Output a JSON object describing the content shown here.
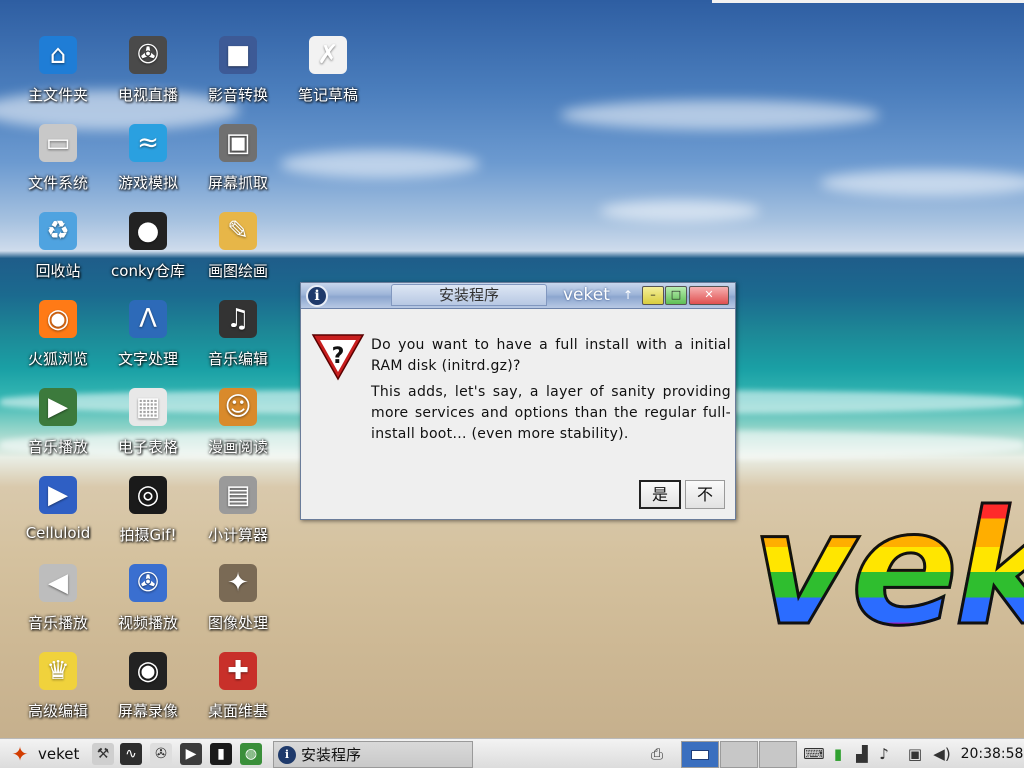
{
  "desktop": {
    "icons": [
      {
        "label": "主文件夹",
        "icon": "home-folder-icon",
        "glyph": "⌂",
        "bg": "#1f7dd6"
      },
      {
        "label": "电视直播",
        "icon": "tv-film-reel-icon",
        "glyph": "✇",
        "bg": "#4a4a4a"
      },
      {
        "label": "影音转换",
        "icon": "video-camera-icon",
        "glyph": "■",
        "bg": "#3d5a96"
      },
      {
        "label": "笔记草稿",
        "icon": "notes-pen-icon",
        "glyph": "✗",
        "bg": "#f2f2f2"
      },
      {
        "label": "文件系统",
        "icon": "hard-drive-icon",
        "glyph": "▭",
        "bg": "#c8c8c8"
      },
      {
        "label": "游戏模拟",
        "icon": "dolphin-icon",
        "glyph": "≈",
        "bg": "#2aa0e0"
      },
      {
        "label": "屏幕抓取",
        "icon": "screenshot-camera-icon",
        "glyph": "▣",
        "bg": "#707070"
      },
      {
        "label": "回收站",
        "icon": "recycle-bin-icon",
        "glyph": "♻",
        "bg": "#4fa3e0"
      },
      {
        "label": "conky仓库",
        "icon": "tux-penguin-icon",
        "glyph": "●",
        "bg": "#222222"
      },
      {
        "label": "画图绘画",
        "icon": "paint-palette-icon",
        "glyph": "✎",
        "bg": "#e7b648"
      },
      {
        "label": "火狐浏览",
        "icon": "firefox-icon",
        "glyph": "◉",
        "bg": "#ff7a16"
      },
      {
        "label": "文字处理",
        "icon": "abiword-icon",
        "glyph": "Λ",
        "bg": "#2d6ab8"
      },
      {
        "label": "音乐编辑",
        "icon": "audio-editor-icon",
        "glyph": "♫",
        "bg": "#333333"
      },
      {
        "label": "音乐播放",
        "icon": "audio-player-icon",
        "glyph": "▶",
        "bg": "#3c7a3c"
      },
      {
        "label": "电子表格",
        "icon": "spreadsheet-icon",
        "glyph": "▦",
        "bg": "#e8e8e8"
      },
      {
        "label": "漫画阅读",
        "icon": "monkey-icon",
        "glyph": "☺",
        "bg": "#d98a2b"
      },
      {
        "label": "Celluloid",
        "icon": "celluloid-film-icon",
        "glyph": "▶",
        "bg": "#2f5fc4"
      },
      {
        "label": "拍摄Gif!",
        "icon": "gif-camera-icon",
        "glyph": "◎",
        "bg": "#1a1a1a"
      },
      {
        "label": "小计算器",
        "icon": "calculator-icon",
        "glyph": "▤",
        "bg": "#9a9a9a"
      },
      {
        "label": "音乐播放",
        "icon": "speaker-icon",
        "glyph": "◀",
        "bg": "#bdbdbd"
      },
      {
        "label": "视频播放",
        "icon": "video-player-icon",
        "glyph": "✇",
        "bg": "#3a6fd0"
      },
      {
        "label": "图像处理",
        "icon": "gimp-icon",
        "glyph": "✦",
        "bg": "#7a6a55"
      },
      {
        "label": "高级编辑",
        "icon": "genie-lamp-icon",
        "glyph": "♛",
        "bg": "#f0d23c"
      },
      {
        "label": "屏幕录像",
        "icon": "screen-recorder-icon",
        "glyph": "◉",
        "bg": "#222222"
      },
      {
        "label": "桌面维基",
        "icon": "desktop-wiki-icon",
        "glyph": "✚",
        "bg": "#c8302a"
      }
    ],
    "logo_text": "veket"
  },
  "dialog": {
    "tab_title": "安装程序",
    "window_title": "veket",
    "pin_glyph": "↑",
    "min_glyph": "–",
    "max_glyph": "□",
    "close_glyph": "✕",
    "info_glyph": "i",
    "message_line1": "Do you want to have a full install with a initial RAM disk (initrd.gz)?",
    "message_line2": "This adds, let's say, a layer of sanity providing more services and options than the regular full-install boot... (even more stability).",
    "yes_label": "是",
    "no_label": "不"
  },
  "taskbar": {
    "start_label": "veket",
    "start_glyph": "✦",
    "quicklaunch": [
      {
        "icon": "paint-roller-icon",
        "glyph": "⚒",
        "bg": "#cfcfcf"
      },
      {
        "icon": "system-monitor-icon",
        "glyph": "∿",
        "bg": "#2e2e2e"
      },
      {
        "icon": "film-reel-icon",
        "glyph": "✇",
        "bg": "#dedede"
      },
      {
        "icon": "media-play-icon",
        "glyph": "▶",
        "bg": "#3c3c3c"
      },
      {
        "icon": "terminal-icon",
        "glyph": "▮",
        "bg": "#1b1b1b"
      },
      {
        "icon": "globe-icon",
        "glyph": "◍",
        "bg": "#3a8f3a"
      }
    ],
    "task_button_label": "安装程序",
    "tray": [
      {
        "icon": "printer-icon",
        "glyph": "⎙"
      },
      {
        "icon": "keyboard-icon",
        "glyph": "⌨"
      },
      {
        "icon": "drive-cylinder-icon",
        "glyph": "▮"
      },
      {
        "icon": "network-signal-icon",
        "glyph": "▟"
      },
      {
        "icon": "mixer-speaker-icon",
        "glyph": "♪"
      },
      {
        "icon": "clipboard-icon",
        "glyph": "▣"
      },
      {
        "icon": "volume-icon",
        "glyph": "◀)"
      }
    ],
    "clock": "20:38:58",
    "colors": {
      "workspace_active": "#3a6fbf",
      "workspace_inactive": "#c7c7c7"
    }
  }
}
